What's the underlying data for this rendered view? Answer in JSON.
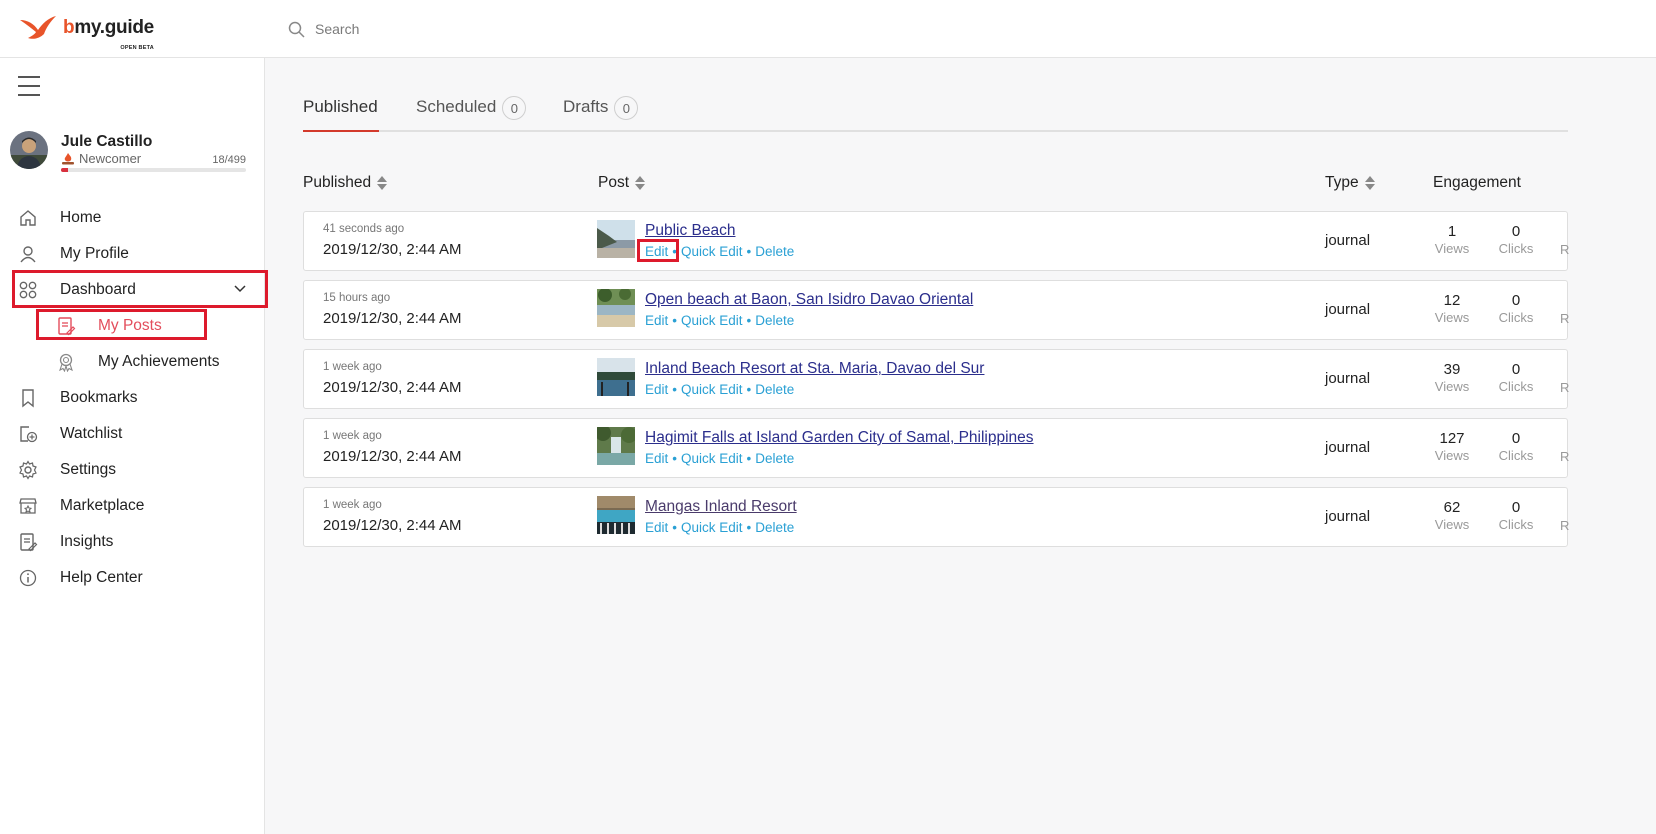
{
  "app": {
    "logo_text": "my.guide",
    "logo_prefix": "b",
    "logo_sub": "OPEN BETA",
    "brand_color": "#e8542a"
  },
  "search": {
    "placeholder": "Search",
    "value": ""
  },
  "user": {
    "name": "Jule Castillo",
    "rank": "Newcomer",
    "points": "18/499",
    "progress_fraction": 0.036
  },
  "sidebar": {
    "items": [
      {
        "label": "Home",
        "icon": "home-icon"
      },
      {
        "label": "My Profile",
        "icon": "user-icon"
      },
      {
        "label": "Dashboard",
        "icon": "dashboard-icon",
        "expanded": true
      },
      {
        "label": "My Posts",
        "icon": "posts-icon",
        "active": true
      },
      {
        "label": "My Achievements",
        "icon": "achievements-icon"
      },
      {
        "label": "Bookmarks",
        "icon": "bookmark-icon"
      },
      {
        "label": "Watchlist",
        "icon": "watchlist-icon"
      },
      {
        "label": "Settings",
        "icon": "gear-icon"
      },
      {
        "label": "Marketplace",
        "icon": "store-icon"
      },
      {
        "label": "Insights",
        "icon": "insights-icon"
      },
      {
        "label": "Help Center",
        "icon": "info-icon"
      }
    ]
  },
  "tabs": [
    {
      "label": "Published",
      "count": null,
      "active": true
    },
    {
      "label": "Scheduled",
      "count": "0"
    },
    {
      "label": "Drafts",
      "count": "0"
    }
  ],
  "table": {
    "headers": {
      "published": "Published",
      "post": "Post",
      "type": "Type",
      "engagement": "Engagement"
    },
    "action_labels": {
      "edit": "Edit",
      "quick_edit": "Quick Edit",
      "delete": "Delete",
      "sep": "•"
    },
    "metric_labels": {
      "views": "Views",
      "clicks": "Clicks",
      "cut": "R"
    },
    "rows": [
      {
        "ago": "41 seconds ago",
        "date": "2019/12/30, 2:44 AM",
        "title": "Public Beach",
        "type": "journal",
        "views": "1",
        "clicks": "0"
      },
      {
        "ago": "15 hours ago",
        "date": "2019/12/30, 2:44 AM",
        "title": "Open beach at Baon, San Isidro Davao Oriental",
        "type": "journal",
        "views": "12",
        "clicks": "0"
      },
      {
        "ago": "1 week ago",
        "date": "2019/12/30, 2:44 AM",
        "title": "Inland Beach Resort at Sta. Maria, Davao del Sur",
        "type": "journal",
        "views": "39",
        "clicks": "0"
      },
      {
        "ago": "1 week ago",
        "date": "2019/12/30, 2:44 AM",
        "title": "Hagimit Falls at Island Garden City of Samal, Philippines",
        "type": "journal",
        "views": "127",
        "clicks": "0"
      },
      {
        "ago": "1 week ago",
        "date": "2019/12/30, 2:44 AM",
        "title": "Mangas Inland Resort",
        "type": "journal",
        "views": "62",
        "clicks": "0"
      }
    ]
  },
  "colors": {
    "accent_red": "#e34d5c",
    "link_blue": "#2aa0d4",
    "title_blue": "#2b2e8c",
    "highlight": "#dd1a2c"
  }
}
